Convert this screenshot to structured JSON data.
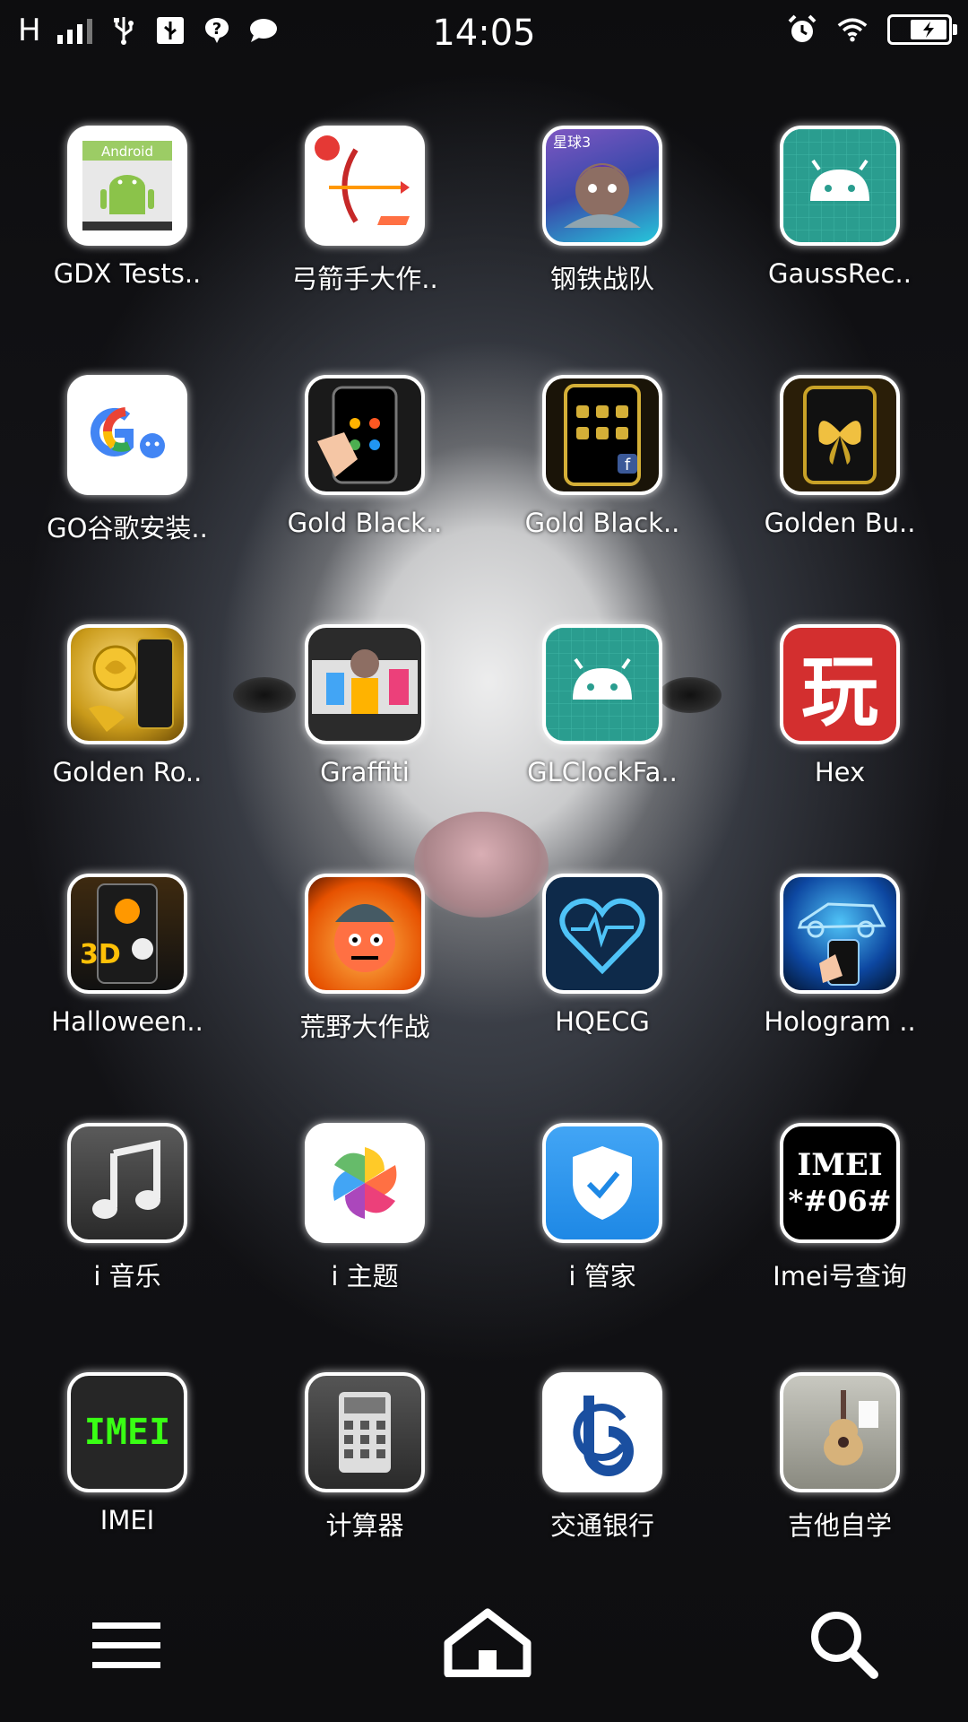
{
  "status_bar": {
    "network": "H",
    "time": "14:05"
  },
  "apps": [
    {
      "label": "GDX Tests..",
      "icon": "android-gdx-icon"
    },
    {
      "label": "弓箭手大作..",
      "icon": "archer-icon"
    },
    {
      "label": "钢铁战队",
      "icon": "steel-team-icon",
      "badge": "星球3"
    },
    {
      "label": "GaussRec..",
      "icon": "android-robot-icon"
    },
    {
      "label": "GO谷歌安装..",
      "icon": "google-go-icon"
    },
    {
      "label": "Gold Black..",
      "icon": "gold-black-theme-icon"
    },
    {
      "label": "Gold Black..",
      "icon": "gold-black-theme-2-icon"
    },
    {
      "label": "Golden Bu..",
      "icon": "golden-butterfly-icon"
    },
    {
      "label": "Golden Ro..",
      "icon": "golden-rose-icon"
    },
    {
      "label": "Graffiti",
      "icon": "graffiti-icon"
    },
    {
      "label": "GLClockFa..",
      "icon": "android-robot-2-icon"
    },
    {
      "label": "Hex",
      "icon": "hex-play-icon",
      "glyph": "玩"
    },
    {
      "label": "Halloween..",
      "icon": "halloween-3d-icon",
      "glyph": "3D"
    },
    {
      "label": "荒野大作战",
      "icon": "wild-battle-icon"
    },
    {
      "label": "HQECG",
      "icon": "heart-ecg-icon"
    },
    {
      "label": "Hologram ..",
      "icon": "hologram-icon"
    },
    {
      "label": "i 音乐",
      "icon": "music-note-icon"
    },
    {
      "label": "i 主题",
      "icon": "theme-pinwheel-icon"
    },
    {
      "label": "i 管家",
      "icon": "shield-check-icon"
    },
    {
      "label": "Imei号查询",
      "icon": "imei-query-icon",
      "glyph_top": "IMEI",
      "glyph_bottom": "*#06#"
    },
    {
      "label": "IMEI",
      "icon": "imei-icon",
      "glyph": "IMEI"
    },
    {
      "label": "计算器",
      "icon": "calculator-icon"
    },
    {
      "label": "交通银行",
      "icon": "bank-comm-icon"
    },
    {
      "label": "吉他自学",
      "icon": "guitar-icon"
    }
  ],
  "dock": {
    "menu": "menu-icon",
    "home": "home-icon",
    "search": "search-icon"
  }
}
